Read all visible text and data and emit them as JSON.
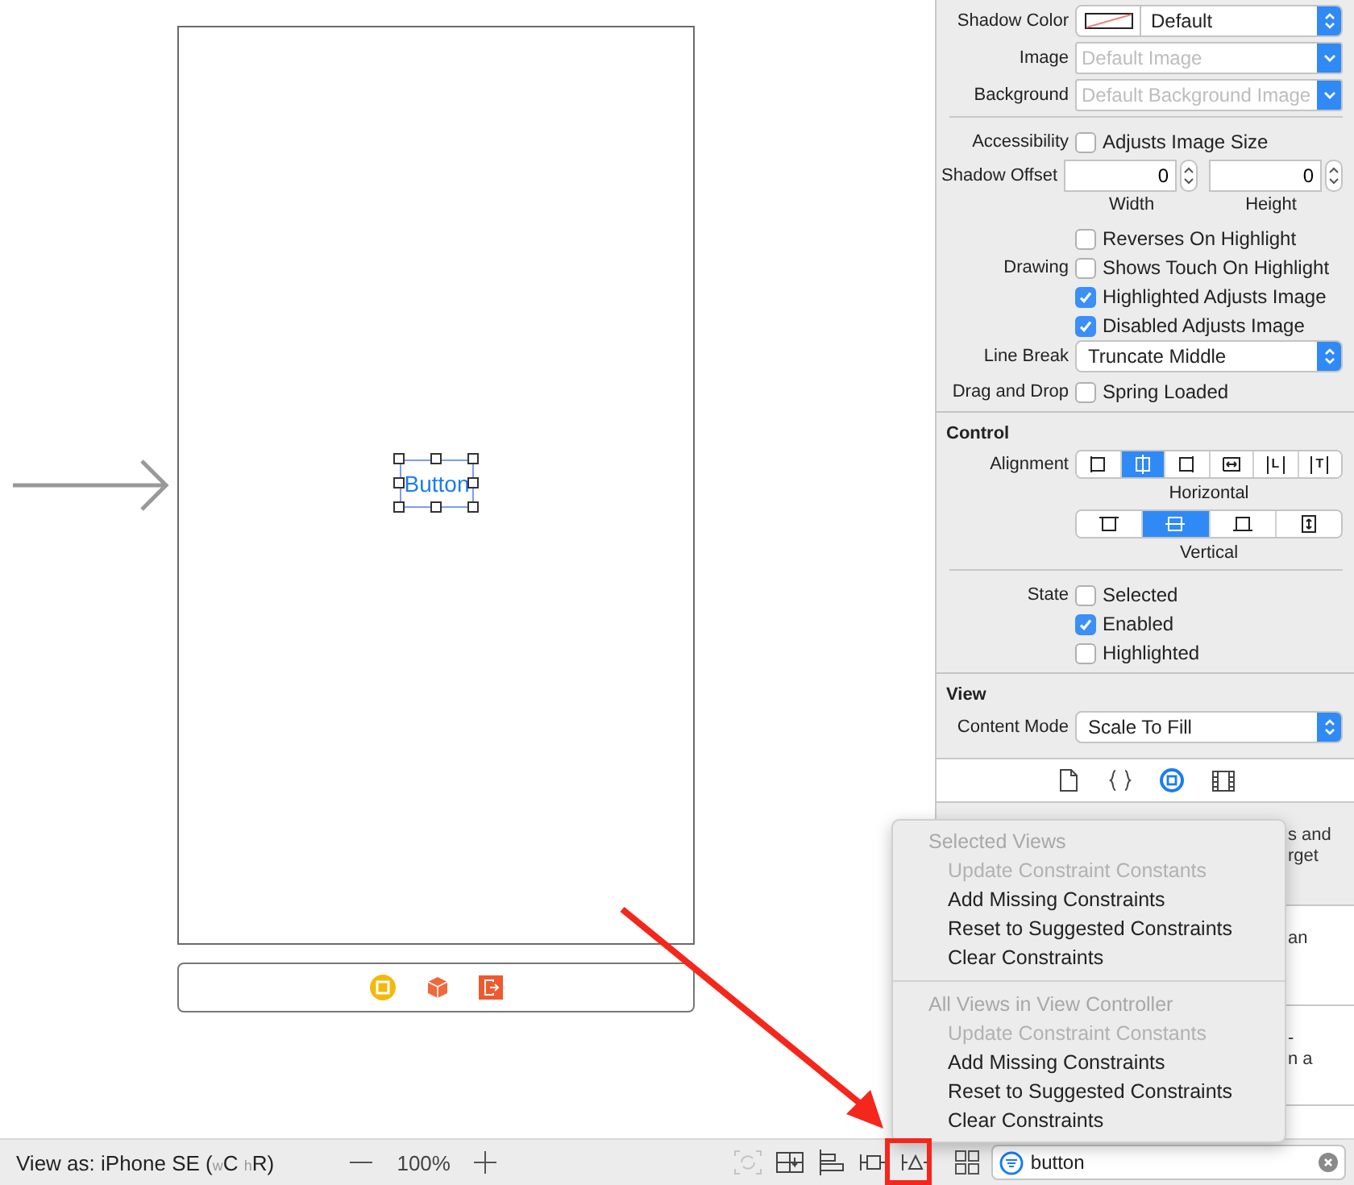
{
  "canvas": {
    "scene_button": {
      "label": "Button",
      "selected": true
    }
  },
  "inspector": {
    "sections": [
      {
        "rows": [
          {
            "kind": "color_popup",
            "label": "Shadow Color",
            "value": "Default"
          },
          {
            "kind": "combo",
            "label": "Image",
            "placeholder": "Default Image"
          },
          {
            "kind": "combo",
            "label": "Background",
            "placeholder": "Default Background Image"
          },
          {
            "kind": "divider"
          },
          {
            "kind": "checkbox",
            "label": "Accessibility",
            "text": "Adjusts Image Size",
            "checked": false
          },
          {
            "kind": "steppers",
            "label": "Shadow Offset",
            "fields": [
              {
                "value": "0",
                "caption": "Width"
              },
              {
                "value": "0",
                "caption": "Height"
              }
            ]
          },
          {
            "kind": "checkbox",
            "text": "Reverses On Highlight",
            "checked": false
          },
          {
            "kind": "checkbox",
            "label": "Drawing",
            "text": "Shows Touch On Highlight",
            "checked": false
          },
          {
            "kind": "checkbox",
            "text": "Highlighted Adjusts Image",
            "checked": true
          },
          {
            "kind": "checkbox",
            "text": "Disabled Adjusts Image",
            "checked": true
          },
          {
            "kind": "popup",
            "label": "Line Break",
            "value": "Truncate Middle"
          },
          {
            "kind": "checkbox",
            "label": "Drag and Drop",
            "text": "Spring Loaded",
            "checked": false
          }
        ]
      },
      {
        "title": "Control",
        "rows": [
          {
            "kind": "segmented",
            "label": "Alignment",
            "caption": "Horizontal",
            "segments": [
              {
                "selected": false
              },
              {
                "selected": true
              },
              {
                "selected": false
              },
              {
                "selected": false
              },
              {
                "glyph": "L",
                "selected": false
              },
              {
                "glyph": "T",
                "selected": false
              }
            ]
          },
          {
            "kind": "segmented",
            "caption": "Vertical",
            "segments": [
              {
                "selected": false
              },
              {
                "selected": true
              },
              {
                "selected": false
              },
              {
                "selected": false
              }
            ]
          },
          {
            "kind": "divider"
          },
          {
            "kind": "checkbox",
            "label": "State",
            "text": "Selected",
            "checked": false
          },
          {
            "kind": "checkbox",
            "text": "Enabled",
            "checked": true
          },
          {
            "kind": "checkbox",
            "text": "Highlighted",
            "checked": false
          }
        ]
      },
      {
        "title": "View",
        "rows": [
          {
            "kind": "popup",
            "label": "Content Mode",
            "value": "Scale To Fill"
          }
        ]
      }
    ],
    "tabs": [
      {
        "selected": false
      },
      {
        "selected": false
      },
      {
        "selected": true
      },
      {
        "selected": false
      }
    ]
  },
  "library_fragments": [
    {
      "lines": [
        "s and",
        "rget"
      ]
    },
    {
      "lines": [
        "an"
      ]
    },
    {
      "lines": [
        "-",
        "n a"
      ]
    }
  ],
  "menu": {
    "sections": [
      {
        "header": "Selected Views",
        "items": [
          {
            "label": "Update Constraint Constants",
            "disabled": true
          },
          {
            "label": "Add Missing Constraints",
            "disabled": false
          },
          {
            "label": "Reset to Suggested Constraints",
            "disabled": false
          },
          {
            "label": "Clear Constraints",
            "disabled": false
          }
        ]
      },
      {
        "header": "All Views in View Controller",
        "items": [
          {
            "label": "Update Constraint Constants",
            "disabled": true
          },
          {
            "label": "Add Missing Constraints",
            "disabled": false
          },
          {
            "label": "Reset to Suggested Constraints",
            "disabled": false
          },
          {
            "label": "Clear Constraints",
            "disabled": false
          }
        ]
      }
    ]
  },
  "bottom_bar": {
    "view_as": "View as: iPhone SE ($_{w}$C $_{h}$R)",
    "zoom": "100%",
    "tools": [
      {
        "disabled": true
      },
      {
        "disabled": false
      },
      {
        "disabled": false
      },
      {
        "disabled": false
      },
      {
        "disabled": false,
        "highlighted": true
      }
    ],
    "search": {
      "value": "button"
    }
  }
}
